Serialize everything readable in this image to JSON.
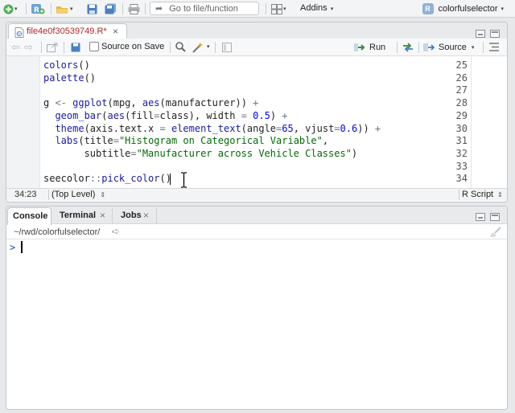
{
  "toolbar": {
    "goto_placeholder": "Go to file/function",
    "addins_label": "Addins",
    "project_name": "colorfulselector"
  },
  "editor": {
    "file_tab": "file4e0f30539749.R*",
    "source_on_save": "Source on Save",
    "run_label": "Run",
    "source_label": "Source",
    "lines": [
      {
        "n": "25",
        "text": "colors()"
      },
      {
        "n": "26",
        "text": "palette()"
      },
      {
        "n": "27",
        "text": ""
      },
      {
        "n": "28",
        "text": "g <- ggplot(mpg, aes(manufacturer)) +"
      },
      {
        "n": "29",
        "text": "  geom_bar(aes(fill=class), width = 0.5) +"
      },
      {
        "n": "30",
        "text": "  theme(axis.text.x = element_text(angle=65, vjust=0.6)) +"
      },
      {
        "n": "31",
        "text": "  labs(title=\"Histogram on Categorical Variable\","
      },
      {
        "n": "32",
        "text": "       subtitle=\"Manufacturer across Vehicle Classes\")"
      },
      {
        "n": "33",
        "text": ""
      },
      {
        "n": "34",
        "text": "seecolor::pick_color()"
      }
    ],
    "cursor_pos": "34:23",
    "scope": "(Top Level)",
    "file_type": "R Script"
  },
  "console": {
    "tabs": [
      "Console",
      "Terminal",
      "Jobs"
    ],
    "path": "~/rwd/colorfulselector/",
    "prompt": ">"
  }
}
